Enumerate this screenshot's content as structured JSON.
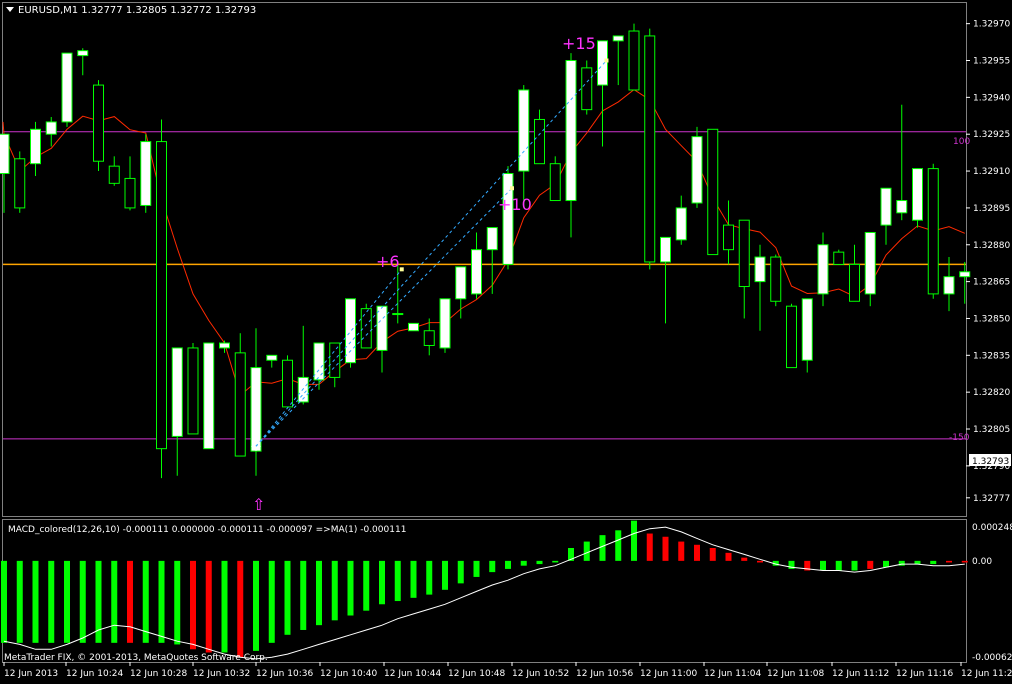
{
  "main_chart": {
    "header": "EURUSD,M1  1.32777 1.32805 1.32772 1.32793",
    "current_price": "1.32793",
    "price_labels": [
      "1.32970",
      "1.32955",
      "1.32940",
      "1.32925",
      "1.32910",
      "1.32895",
      "1.32880",
      "1.32865",
      "1.32850",
      "1.32835",
      "1.32820",
      "1.32805",
      "1.32790",
      "1.32777"
    ],
    "level_high_label": "100",
    "level_low_label": "-150",
    "annotations": [
      "+6",
      "+10",
      "+15"
    ],
    "arrow_glyph": "⇧"
  },
  "macd": {
    "header": "MACD_colored(12,26,10) -0.000111 0.000000 -0.000111 -0.000097  =>MA(1) -0.000111",
    "axis_labels": [
      "0.000248",
      "0.00",
      "-0.000623"
    ]
  },
  "footer": {
    "copyright": "MetaTrader FIX, © 2001-2013, MetaQuotes Software Corp."
  },
  "time_labels": [
    "12 Jun 2013",
    "12 Jun 10:24",
    "12 Jun 10:28",
    "12 Jun 10:32",
    "12 Jun 10:36",
    "12 Jun 10:40",
    "12 Jun 10:44",
    "12 Jun 10:48",
    "12 Jun 10:52",
    "12 Jun 10:56",
    "12 Jun 11:00",
    "12 Jun 11:04",
    "12 Jun 11:08",
    "12 Jun 11:12",
    "12 Jun 11:16",
    "12 Jun 11:20"
  ],
  "colors": {
    "background": "#000000",
    "bull_candle": "#ffffff",
    "bear_candle": "#000000",
    "candle_outline": "#00ff00",
    "moving_average": "#ff2a00",
    "level_line": "#cc33cc",
    "horizontal_line": "#ffa500",
    "annotation": "#ff33ff",
    "trend_dash": "#33aaff",
    "macd_up": "#00ff00",
    "macd_down": "#ff0000",
    "signal_line": "#ffffff"
  },
  "chart_data": {
    "type": "candlestick",
    "symbol": "EURUSD,M1",
    "ylim": [
      1.3277,
      1.32978
    ],
    "level_lines": [
      1.32926,
      1.32801
    ],
    "horizontal_line": 1.32872,
    "candles": [
      {
        "o": 1.32909,
        "h": 1.3292,
        "l": 1.32893,
        "c": 1.32925
      },
      {
        "o": 1.32915,
        "h": 1.32918,
        "l": 1.32893,
        "c": 1.32895
      },
      {
        "o": 1.32913,
        "h": 1.3293,
        "l": 1.32908,
        "c": 1.32927
      },
      {
        "o": 1.32925,
        "h": 1.32932,
        "l": 1.3292,
        "c": 1.3293
      },
      {
        "o": 1.3293,
        "h": 1.32958,
        "l": 1.32928,
        "c": 1.32958
      },
      {
        "o": 1.32957,
        "h": 1.3296,
        "l": 1.32949,
        "c": 1.32959
      },
      {
        "o": 1.32945,
        "h": 1.32947,
        "l": 1.3291,
        "c": 1.32914
      },
      {
        "o": 1.32912,
        "h": 1.32916,
        "l": 1.32904,
        "c": 1.32905
      },
      {
        "o": 1.32907,
        "h": 1.32916,
        "l": 1.32894,
        "c": 1.32895
      },
      {
        "o": 1.32896,
        "h": 1.32925,
        "l": 1.32893,
        "c": 1.32922
      },
      {
        "o": 1.32922,
        "h": 1.32931,
        "l": 1.32785,
        "c": 1.32797
      },
      {
        "o": 1.32802,
        "h": 1.32838,
        "l": 1.32786,
        "c": 1.32838
      },
      {
        "o": 1.32838,
        "h": 1.3284,
        "l": 1.32803,
        "c": 1.32803
      },
      {
        "o": 1.32797,
        "h": 1.3284,
        "l": 1.32797,
        "c": 1.3284
      },
      {
        "o": 1.32838,
        "h": 1.32841,
        "l": 1.32836,
        "c": 1.3284
      },
      {
        "o": 1.32836,
        "h": 1.32844,
        "l": 1.32794,
        "c": 1.32794
      },
      {
        "o": 1.32796,
        "h": 1.32846,
        "l": 1.32786,
        "c": 1.3283
      },
      {
        "o": 1.32833,
        "h": 1.32835,
        "l": 1.3283,
        "c": 1.32835
      },
      {
        "o": 1.32833,
        "h": 1.32835,
        "l": 1.32814,
        "c": 1.32814
      },
      {
        "o": 1.32816,
        "h": 1.32847,
        "l": 1.32815,
        "c": 1.32826
      },
      {
        "o": 1.32825,
        "h": 1.3284,
        "l": 1.32821,
        "c": 1.3284
      },
      {
        "o": 1.3284,
        "h": 1.3284,
        "l": 1.32822,
        "c": 1.32826
      },
      {
        "o": 1.32832,
        "h": 1.32858,
        "l": 1.3283,
        "c": 1.32858
      },
      {
        "o": 1.32854,
        "h": 1.32856,
        "l": 1.32838,
        "c": 1.32838
      },
      {
        "o": 1.32837,
        "h": 1.32855,
        "l": 1.32828,
        "c": 1.32855
      },
      {
        "o": 1.32852,
        "h": 1.32872,
        "l": 1.32848,
        "c": 1.32852
      },
      {
        "o": 1.32845,
        "h": 1.32848,
        "l": 1.32845,
        "c": 1.32848
      },
      {
        "o": 1.32845,
        "h": 1.3285,
        "l": 1.32835,
        "c": 1.32839
      },
      {
        "o": 1.32838,
        "h": 1.32858,
        "l": 1.32836,
        "c": 1.32858
      },
      {
        "o": 1.32858,
        "h": 1.32871,
        "l": 1.3285,
        "c": 1.32871
      },
      {
        "o": 1.3286,
        "h": 1.32885,
        "l": 1.32858,
        "c": 1.32878
      },
      {
        "o": 1.32878,
        "h": 1.32887,
        "l": 1.3286,
        "c": 1.32887
      },
      {
        "o": 1.32872,
        "h": 1.32912,
        "l": 1.3287,
        "c": 1.32909
      },
      {
        "o": 1.3291,
        "h": 1.32945,
        "l": 1.32895,
        "c": 1.32943
      },
      {
        "o": 1.32931,
        "h": 1.32935,
        "l": 1.32913,
        "c": 1.32913
      },
      {
        "o": 1.32913,
        "h": 1.32916,
        "l": 1.32901,
        "c": 1.32898
      },
      {
        "o": 1.32898,
        "h": 1.32958,
        "l": 1.32883,
        "c": 1.32955
      },
      {
        "o": 1.32952,
        "h": 1.32955,
        "l": 1.32933,
        "c": 1.32935
      },
      {
        "o": 1.32945,
        "h": 1.32963,
        "l": 1.3292,
        "c": 1.32963
      },
      {
        "o": 1.32963,
        "h": 1.32965,
        "l": 1.32945,
        "c": 1.32965
      },
      {
        "o": 1.32967,
        "h": 1.3297,
        "l": 1.32943,
        "c": 1.32943
      },
      {
        "o": 1.32965,
        "h": 1.32968,
        "l": 1.3287,
        "c": 1.32873
      },
      {
        "o": 1.32873,
        "h": 1.3288,
        "l": 1.32848,
        "c": 1.32883
      },
      {
        "o": 1.32882,
        "h": 1.329,
        "l": 1.3288,
        "c": 1.32895
      },
      {
        "o": 1.32897,
        "h": 1.32928,
        "l": 1.32895,
        "c": 1.32924
      },
      {
        "o": 1.32927,
        "h": 1.32927,
        "l": 1.32876,
        "c": 1.32876
      },
      {
        "o": 1.32888,
        "h": 1.32898,
        "l": 1.32872,
        "c": 1.32878
      },
      {
        "o": 1.3289,
        "h": 1.3289,
        "l": 1.3285,
        "c": 1.32863
      },
      {
        "o": 1.32865,
        "h": 1.3288,
        "l": 1.32845,
        "c": 1.32875
      },
      {
        "o": 1.32875,
        "h": 1.32876,
        "l": 1.32855,
        "c": 1.32857
      },
      {
        "o": 1.32855,
        "h": 1.32856,
        "l": 1.3283,
        "c": 1.3283
      },
      {
        "o": 1.32833,
        "h": 1.32858,
        "l": 1.32828,
        "c": 1.32858
      },
      {
        "o": 1.3286,
        "h": 1.32885,
        "l": 1.32855,
        "c": 1.3288
      },
      {
        "o": 1.32877,
        "h": 1.32878,
        "l": 1.32872,
        "c": 1.32872
      },
      {
        "o": 1.32872,
        "h": 1.3288,
        "l": 1.32857,
        "c": 1.32857
      },
      {
        "o": 1.3286,
        "h": 1.32885,
        "l": 1.32855,
        "c": 1.32885
      },
      {
        "o": 1.32888,
        "h": 1.32903,
        "l": 1.3288,
        "c": 1.32903
      },
      {
        "o": 1.32893,
        "h": 1.32937,
        "l": 1.3289,
        "c": 1.32898
      },
      {
        "o": 1.3289,
        "h": 1.32911,
        "l": 1.32887,
        "c": 1.32911
      },
      {
        "o": 1.32911,
        "h": 1.32913,
        "l": 1.32858,
        "c": 1.3286
      },
      {
        "o": 1.3286,
        "h": 1.32875,
        "l": 1.32853,
        "c": 1.32867
      },
      {
        "o": 1.32867,
        "h": 1.32873,
        "l": 1.32856,
        "c": 1.32869
      }
    ],
    "macd": {
      "ylim": [
        -0.000623,
        0.000248
      ],
      "histogram": [
        -0.00051,
        -0.00051,
        -0.00051,
        -0.00051,
        -0.00051,
        -0.00051,
        -0.00051,
        -0.00051,
        -0.00051,
        -0.00051,
        -0.00051,
        -0.00052,
        -0.00055,
        -0.00057,
        -0.00057,
        -0.0006,
        -0.00056,
        -0.00051,
        -0.00046,
        -0.00043,
        -0.0004,
        -0.00037,
        -0.00034,
        -0.00031,
        -0.00027,
        -0.00025,
        -0.00023,
        -0.00021,
        -0.00018,
        -0.00014,
        -0.0001,
        -7e-05,
        -5e-05,
        -3e-05,
        -2e-05,
        -1e-05,
        8e-05,
        0.00012,
        0.00016,
        0.00019,
        0.00025,
        0.00017,
        0.00015,
        0.00012,
        0.0001,
        8e-05,
        5e-05,
        2e-05,
        -1e-05,
        -3e-05,
        -5e-05,
        -6e-05,
        -6e-05,
        -6e-05,
        -6e-05,
        -5e-05,
        -4e-05,
        -3e-05,
        -2e-05,
        -2e-05,
        -1e-05,
        -1e-05
      ],
      "directions": [
        "up",
        "up",
        "up",
        "up",
        "up",
        "up",
        "up",
        "up",
        "down",
        "up",
        "up",
        "up",
        "down",
        "down",
        "up",
        "down",
        "up",
        "up",
        "up",
        "up",
        "up",
        "up",
        "up",
        "up",
        "up",
        "up",
        "up",
        "up",
        "up",
        "up",
        "up",
        "up",
        "up",
        "up",
        "up",
        "up",
        "up",
        "up",
        "up",
        "up",
        "up",
        "down",
        "down",
        "down",
        "down",
        "down",
        "down",
        "down",
        "down",
        "up",
        "up",
        "down",
        "up",
        "up",
        "up",
        "down",
        "up",
        "up",
        "up",
        "up",
        "down",
        "down"
      ],
      "signal": [
        -0.0005,
        -0.00052,
        -0.00055,
        -0.00055,
        -0.00052,
        -0.00048,
        -0.00043,
        -0.0004,
        -0.00041,
        -0.00044,
        -0.00047,
        -0.0005,
        -0.00052,
        -0.00055,
        -0.00058,
        -0.0006,
        -0.00061,
        -0.0006,
        -0.00058,
        -0.00055,
        -0.00052,
        -0.00049,
        -0.00046,
        -0.00043,
        -0.0004,
        -0.00036,
        -0.00033,
        -0.0003,
        -0.00027,
        -0.00023,
        -0.00019,
        -0.00015,
        -0.00012,
        -8e-05,
        -5e-05,
        -3e-05,
        1e-05,
        5e-05,
        9e-05,
        0.00013,
        0.00017,
        0.0002,
        0.00021,
        0.00018,
        0.00014,
        0.0001,
        7e-05,
        4e-05,
        1e-05,
        -2e-05,
        -4e-05,
        -5e-05,
        -6e-05,
        -6e-05,
        -7e-05,
        -6e-05,
        -4e-05,
        -2e-05,
        -2e-05,
        -3e-05,
        -3e-05,
        -2e-05
      ]
    }
  }
}
